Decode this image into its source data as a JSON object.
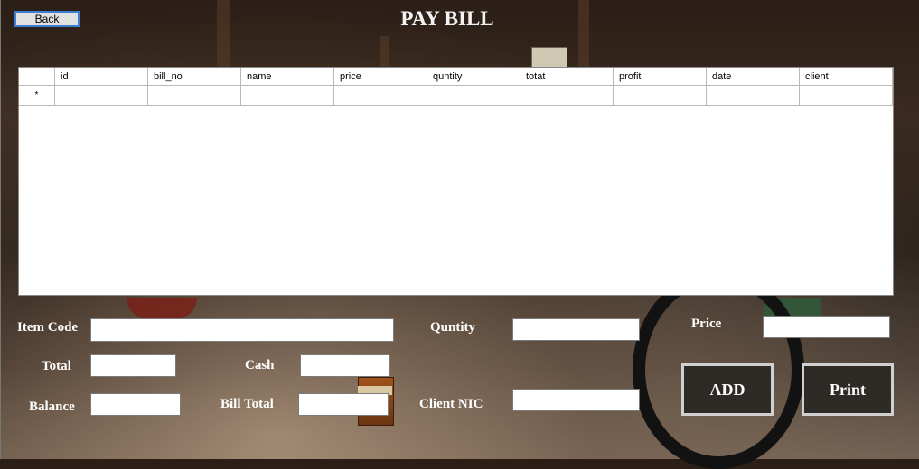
{
  "window": {
    "title": "PAY BILL"
  },
  "toolbar": {
    "back_label": "Back"
  },
  "grid": {
    "columns": [
      "id",
      "bill_no",
      "name",
      "price",
      "quntity",
      "totat",
      "profit",
      "date",
      "client"
    ],
    "new_row_marker": "*",
    "rows": []
  },
  "form": {
    "item_code_label": "Item Code",
    "quantity_label": "Quntity",
    "price_label": "Price",
    "total_label": "Total",
    "cash_label": "Cash",
    "balance_label": "Balance",
    "bill_total_label": "Bill Total",
    "client_nic_label": "Client NIC",
    "item_code_value": "",
    "quantity_value": "",
    "price_value": "",
    "total_value": "",
    "cash_value": "",
    "balance_value": "",
    "bill_total_value": "",
    "client_nic_value": ""
  },
  "actions": {
    "add_label": "ADD",
    "print_label": "Print"
  }
}
